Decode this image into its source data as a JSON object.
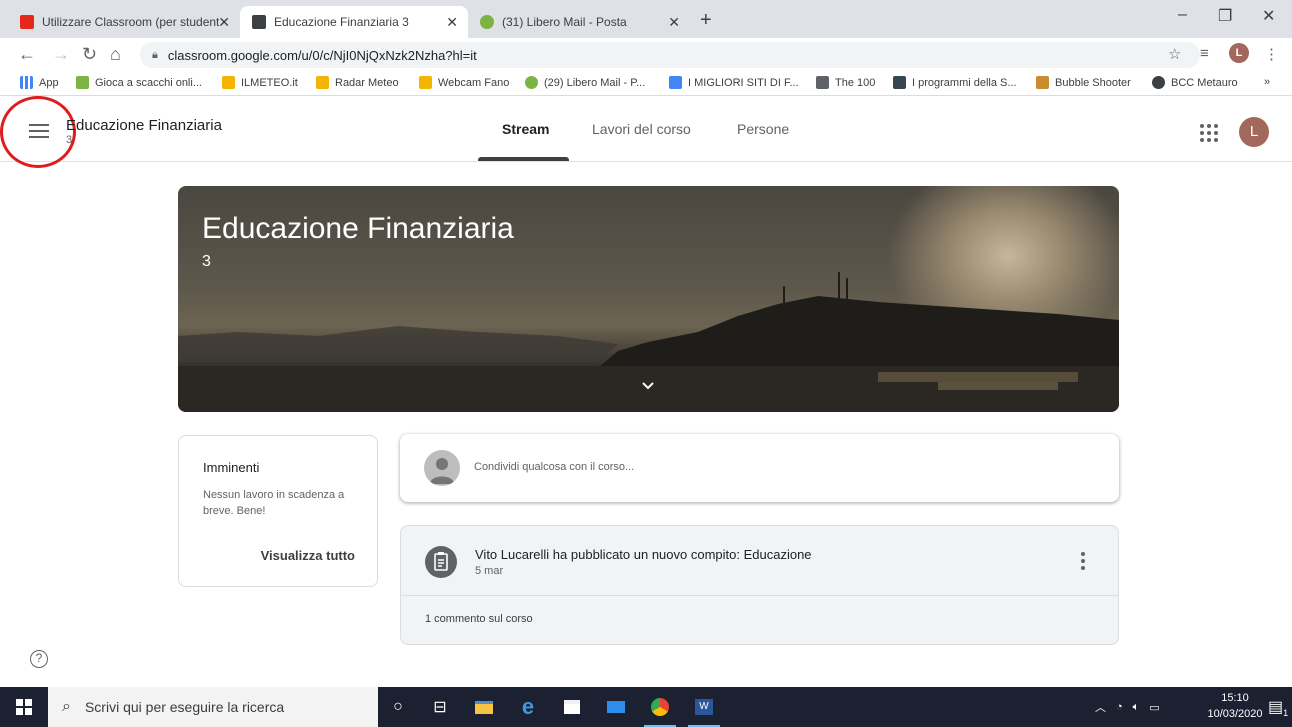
{
  "browser": {
    "tabs": [
      {
        "title": "Utilizzare Classroom (per student",
        "favicon_color": "#e8271b",
        "active": false
      },
      {
        "title": "Educazione Finanziaria 3",
        "favicon_color": "#3c4043",
        "active": true
      },
      {
        "title": "(31) Libero Mail - Posta",
        "favicon_color": "#7cb342",
        "active": false
      }
    ],
    "url": "classroom.google.com/u/0/c/NjI0NjQxNzk2Nzha?hl=it",
    "profile_initial": "L",
    "bookmarks": [
      {
        "label": "App",
        "color": "#4285f4"
      },
      {
        "label": "Gioca a scacchi onli...",
        "color": "#7cb342"
      },
      {
        "label": "ILMETEO.it",
        "color": "#f4b400"
      },
      {
        "label": "Radar Meteo",
        "color": "#f4b400"
      },
      {
        "label": "Webcam Fano",
        "color": "#f4b400"
      },
      {
        "label": "(29) Libero Mail - P...",
        "color": "#7cb342"
      },
      {
        "label": "I MIGLIORI SITI DI F...",
        "color": "#4285f4"
      },
      {
        "label": "The 100",
        "color": "#5f6368"
      },
      {
        "label": "I programmi della S...",
        "color": "#37474f"
      },
      {
        "label": "Bubble Shooter",
        "color": "#c98b2e"
      },
      {
        "label": "BCC Metauro",
        "color": "#3c4043"
      }
    ],
    "bookmarks_more": "»"
  },
  "classroom": {
    "course_title": "Educazione Finanziaria",
    "course_section": "3",
    "tabs": [
      "Stream",
      "Lavori del corso",
      "Persone"
    ],
    "active_tab": "Stream",
    "avatar_initial": "L",
    "banner": {
      "title": "Educazione Finanziaria",
      "subtitle": "3"
    },
    "upcoming": {
      "title": "Imminenti",
      "description": "Nessun lavoro in scadenza a breve. Bene!",
      "link": "Visualizza tutto"
    },
    "share_placeholder": "Condividi qualcosa con il corso...",
    "post": {
      "title": "Vito Lucarelli ha pubblicato un nuovo compito: Educazione",
      "date": "5 mar",
      "comments": "1 commento sul corso"
    },
    "help": "?"
  },
  "taskbar": {
    "search_placeholder": "Scrivi qui per eseguire la ricerca",
    "time": "15:10",
    "date": "10/03/2020",
    "notification_count": "1"
  },
  "colors": {
    "accent_dark": "#3c4043",
    "highlight_circle": "#e01c1c",
    "taskbar_bg": "#1b2130"
  }
}
